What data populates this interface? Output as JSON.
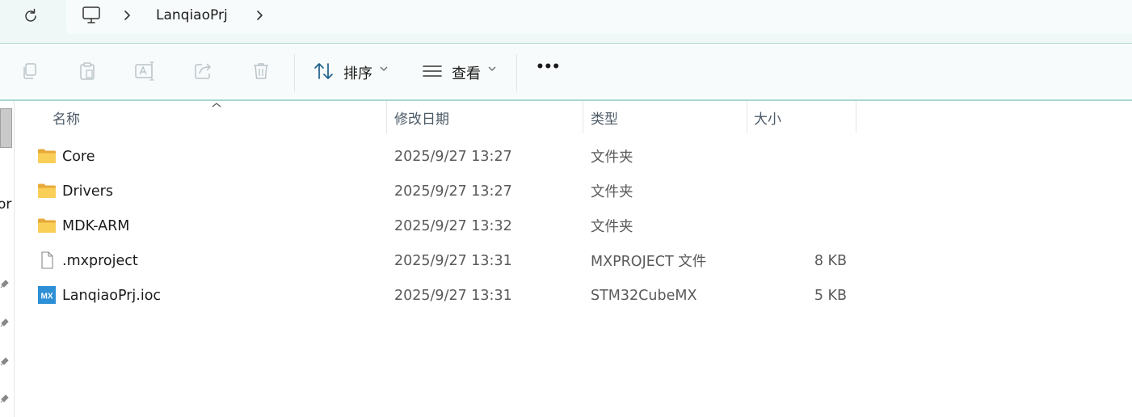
{
  "breadcrumb": {
    "items": [
      {
        "icon": "this-pc-icon"
      },
      {
        "label": "LanqiaoPrj"
      }
    ]
  },
  "toolbar": {
    "sort_label": "排序",
    "view_label": "查看",
    "more_label": "•••"
  },
  "nav": {
    "truncated_label": "or"
  },
  "columns": {
    "name": "名称",
    "modified": "修改日期",
    "type": "类型",
    "size": "大小"
  },
  "files": [
    {
      "name": "Core",
      "modified": "2025/9/27 13:27",
      "type": "文件夹",
      "size": "",
      "icon": "folder-icon"
    },
    {
      "name": "Drivers",
      "modified": "2025/9/27 13:27",
      "type": "文件夹",
      "size": "",
      "icon": "folder-icon"
    },
    {
      "name": "MDK-ARM",
      "modified": "2025/9/27 13:32",
      "type": "文件夹",
      "size": "",
      "icon": "folder-icon"
    },
    {
      "name": ".mxproject",
      "modified": "2025/9/27 13:31",
      "type": "MXPROJECT 文件",
      "size": "8 KB",
      "icon": "file-icon"
    },
    {
      "name": "LanqiaoPrj.ioc",
      "modified": "2025/9/27 13:31",
      "type": "STM32CubeMX",
      "size": "5 KB",
      "icon": "mx-file-icon"
    }
  ],
  "colors": {
    "accent": "#a9d6d1",
    "folder": "#f5c042",
    "mx_icon": "#2d8fd5"
  }
}
